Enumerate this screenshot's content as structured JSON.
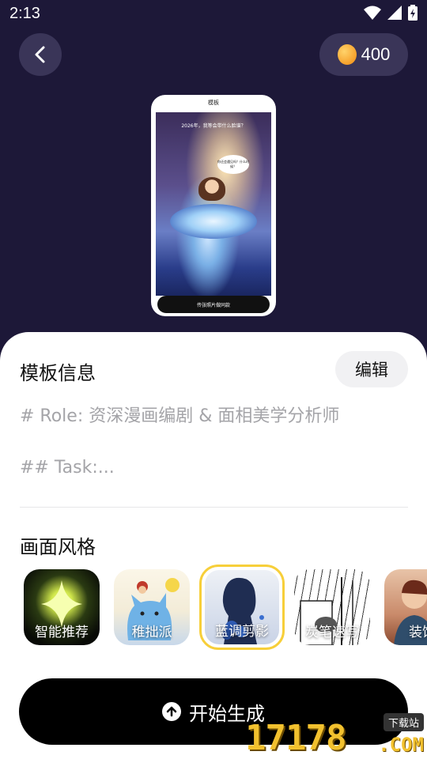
{
  "status_bar": {
    "time": "2:13"
  },
  "header": {
    "coins": "400"
  },
  "preview": {
    "screen_title": "模板",
    "caption": "2026年，我等会带什么脸谱？",
    "bubble_text": "你还会遇见吗？什么时候？",
    "cta": "传张照片做同款"
  },
  "template_info": {
    "title": "模板信息",
    "edit_label": "编辑",
    "prompt_lines": [
      "# Role: 资深漫画编剧 & 面相美学分析师",
      "## Task:..."
    ]
  },
  "style": {
    "title": "画面风格",
    "options": [
      {
        "label": "智能推荐",
        "selected": false
      },
      {
        "label": "稚拙派",
        "selected": false
      },
      {
        "label": "蓝调剪影",
        "selected": true
      },
      {
        "label": "炭笔速写",
        "selected": false
      },
      {
        "label": "装饰",
        "selected": false
      }
    ],
    "selected_color": "#f7cf3a"
  },
  "generate_button": {
    "label": "开始生成"
  },
  "watermark": {
    "text": "17178",
    "tag": "下载站",
    "suffix": ".COM"
  }
}
